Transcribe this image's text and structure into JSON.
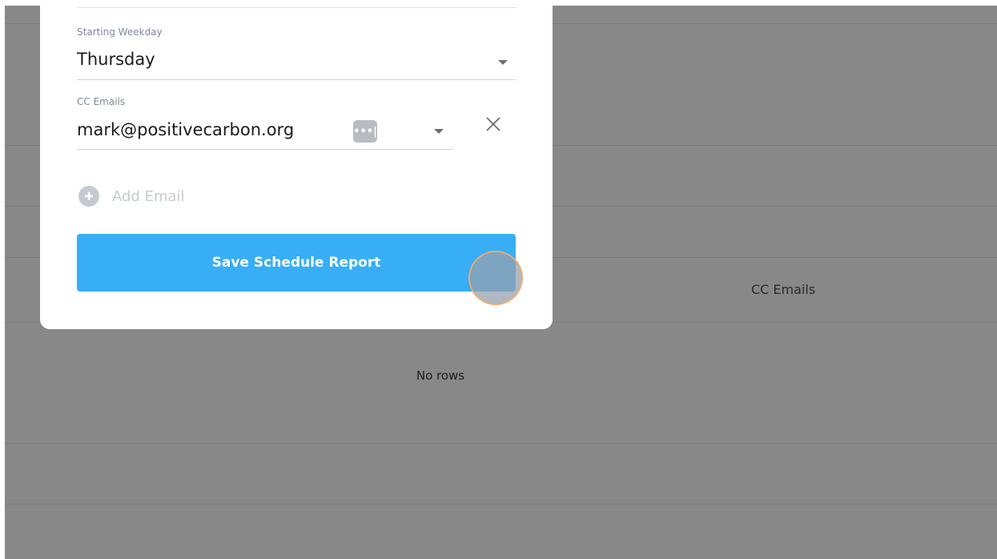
{
  "background_table": {
    "column_header": "CC Emails",
    "empty_message": "No rows"
  },
  "modal": {
    "starting_weekday": {
      "label": "Starting Weekday",
      "value": "Thursday"
    },
    "cc_emails": {
      "label": "CC Emails",
      "entries": [
        {
          "value": "mark@positivecarbon.org",
          "badge_icon": "password-manager-dots-icon"
        }
      ]
    },
    "add_email_label": "Add Email",
    "save_button_label": "Save Schedule Report"
  },
  "colors": {
    "primary_button": "#37aef6",
    "overlay": "#888888",
    "click_indicator_border": "#f5aa6e"
  }
}
